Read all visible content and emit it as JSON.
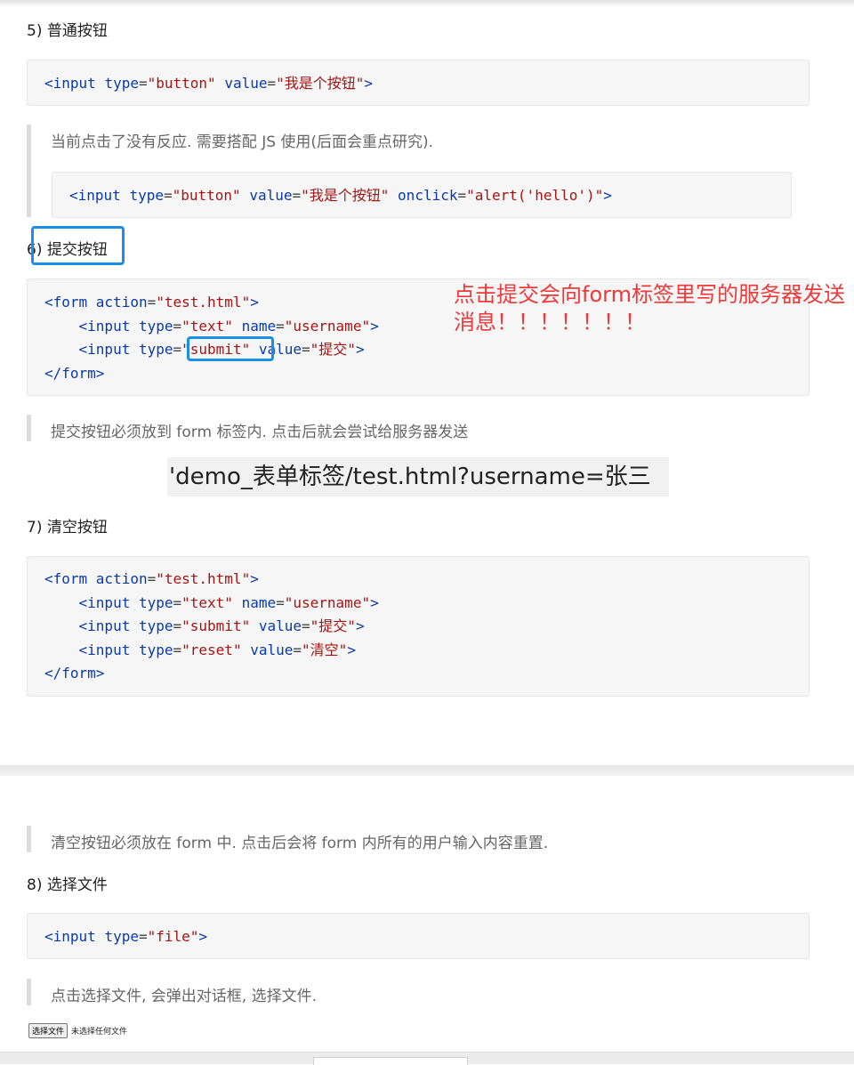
{
  "sections": {
    "s5": {
      "heading": "5) 普通按钮",
      "code": [
        [
          [
            "t",
            "<input "
          ],
          [
            "a",
            "type"
          ],
          [
            "e",
            "="
          ],
          [
            "s",
            "\"button\""
          ],
          [
            "p",
            " "
          ],
          [
            "a",
            "value"
          ],
          [
            "e",
            "="
          ],
          [
            "s",
            "\"我是个按钮\""
          ],
          [
            "t",
            ">"
          ]
        ]
      ],
      "note": "当前点击了没有反应. 需要搭配 JS 使用(后面会重点研究).",
      "nested_code": [
        [
          [
            "t",
            "<input "
          ],
          [
            "a",
            "type"
          ],
          [
            "e",
            "="
          ],
          [
            "s",
            "\"button\""
          ],
          [
            "p",
            " "
          ],
          [
            "a",
            "value"
          ],
          [
            "e",
            "="
          ],
          [
            "s",
            "\"我是个按钮\""
          ],
          [
            "p",
            " "
          ],
          [
            "a",
            "onclick"
          ],
          [
            "e",
            "="
          ],
          [
            "s",
            "\"alert('hello')\""
          ],
          [
            "t",
            ">"
          ]
        ]
      ]
    },
    "s6": {
      "heading": "6) 提交按钮",
      "code": [
        [
          [
            "t",
            "<form "
          ],
          [
            "a",
            "action"
          ],
          [
            "e",
            "="
          ],
          [
            "s",
            "\"test.html\""
          ],
          [
            "t",
            ">"
          ]
        ],
        [
          [
            "p",
            "    "
          ],
          [
            "t",
            "<input "
          ],
          [
            "a",
            "type"
          ],
          [
            "e",
            "="
          ],
          [
            "s",
            "\"text\""
          ],
          [
            "p",
            " "
          ],
          [
            "a",
            "name"
          ],
          [
            "e",
            "="
          ],
          [
            "s",
            "\"username\""
          ],
          [
            "t",
            ">"
          ]
        ],
        [
          [
            "p",
            "    "
          ],
          [
            "t",
            "<input "
          ],
          [
            "a",
            "type"
          ],
          [
            "e",
            "="
          ],
          [
            "s",
            "\"submit\""
          ],
          [
            "p",
            " "
          ],
          [
            "a",
            "value"
          ],
          [
            "e",
            "="
          ],
          [
            "s",
            "\"提交\""
          ],
          [
            "t",
            ">"
          ]
        ],
        [
          [
            "t",
            "</form>"
          ]
        ]
      ],
      "annotation": "点击提交会向form标签里写的服务器发送消息！！！！！！！",
      "note": "提交按钮必须放到 form 标签内. 点击后就会尝试给服务器发送",
      "url": "'demo_表单标签/test.html?username=张三"
    },
    "s7": {
      "heading": "7) 清空按钮",
      "code": [
        [
          [
            "t",
            "<form "
          ],
          [
            "a",
            "action"
          ],
          [
            "e",
            "="
          ],
          [
            "s",
            "\"test.html\""
          ],
          [
            "t",
            ">"
          ]
        ],
        [
          [
            "p",
            "    "
          ],
          [
            "t",
            "<input "
          ],
          [
            "a",
            "type"
          ],
          [
            "e",
            "="
          ],
          [
            "s",
            "\"text\""
          ],
          [
            "p",
            " "
          ],
          [
            "a",
            "name"
          ],
          [
            "e",
            "="
          ],
          [
            "s",
            "\"username\""
          ],
          [
            "t",
            ">"
          ]
        ],
        [
          [
            "p",
            "    "
          ],
          [
            "t",
            "<input "
          ],
          [
            "a",
            "type"
          ],
          [
            "e",
            "="
          ],
          [
            "s",
            "\"submit\""
          ],
          [
            "p",
            " "
          ],
          [
            "a",
            "value"
          ],
          [
            "e",
            "="
          ],
          [
            "s",
            "\"提交\""
          ],
          [
            "t",
            ">"
          ]
        ],
        [
          [
            "p",
            "    "
          ],
          [
            "t",
            "<input "
          ],
          [
            "a",
            "type"
          ],
          [
            "e",
            "="
          ],
          [
            "s",
            "\"reset\""
          ],
          [
            "p",
            " "
          ],
          [
            "a",
            "value"
          ],
          [
            "e",
            "="
          ],
          [
            "s",
            "\"清空\""
          ],
          [
            "t",
            ">"
          ]
        ],
        [
          [
            "t",
            "</form>"
          ]
        ]
      ],
      "note": "清空按钮必须放在 form 中. 点击后会将 form 内所有的用户输入内容重置."
    },
    "s8": {
      "heading": "8) 选择文件",
      "code": [
        [
          [
            "t",
            "<input "
          ],
          [
            "a",
            "type"
          ],
          [
            "e",
            "="
          ],
          [
            "s",
            "\"file\""
          ],
          [
            "t",
            ">"
          ]
        ]
      ],
      "note": "点击选择文件, 会弹出对话框, 选择文件.",
      "file_button": "选择文件",
      "file_status": "未选择任何文件"
    }
  },
  "colors": {
    "tag": "#0a3aa6",
    "string": "#a31515",
    "annotation": "#ee3a3a",
    "highlight_box": "#1b8fe5"
  }
}
